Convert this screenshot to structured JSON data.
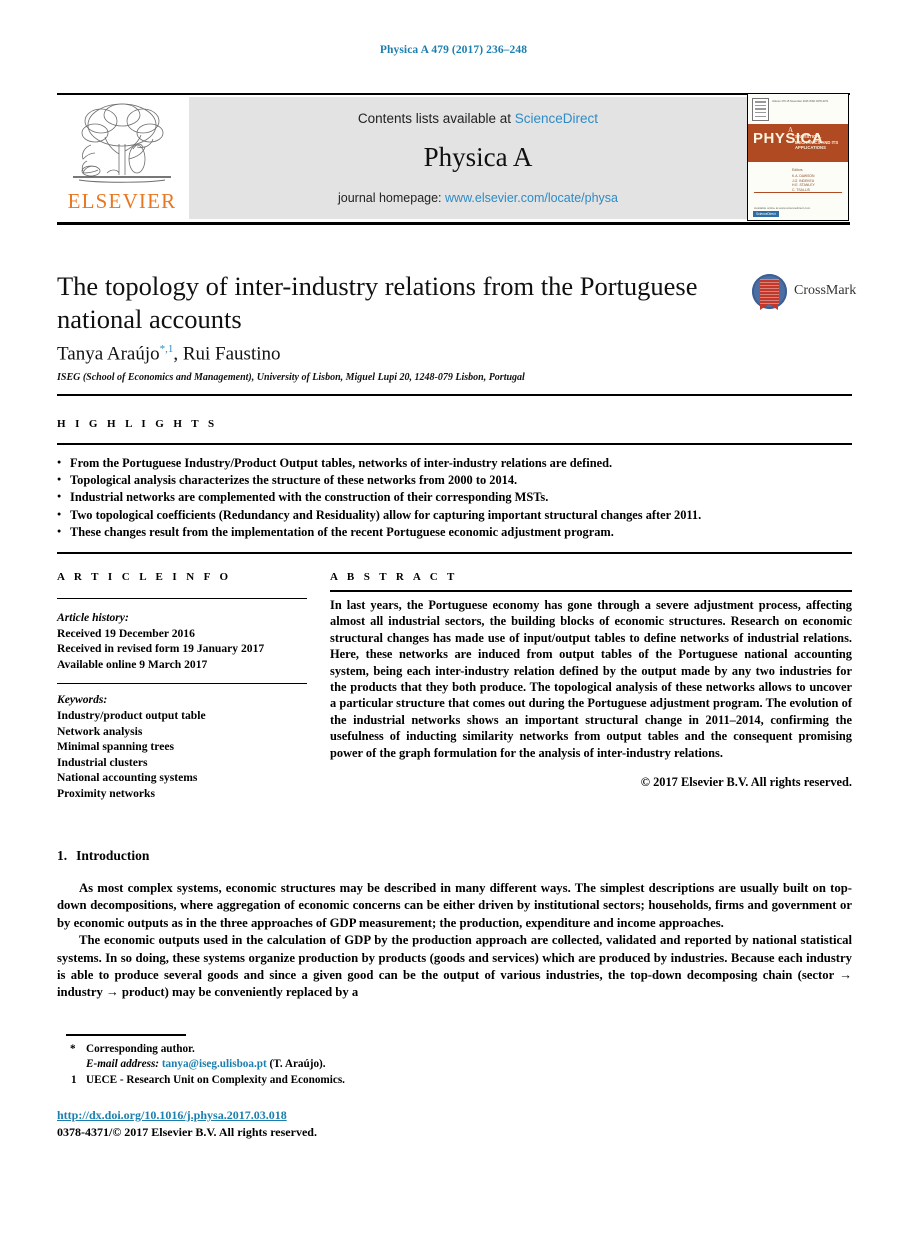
{
  "running_head": "Physica A 479 (2017) 236–248",
  "masthead": {
    "publisher_name": "ELSEVIER",
    "contents_prefix": "Contents lists available at",
    "contents_link": "ScienceDirect",
    "journal_title": "Physica A",
    "homepage_prefix": "journal homepage:",
    "homepage_link": "www.elsevier.com/locate/physa",
    "cover": {
      "title": "PHYSICA",
      "volume_letter": "A",
      "subtitle": "STATISTICAL MECHANICS AND ITS APPLICATIONS",
      "editors_label": "Editors",
      "editors": "K.A. DAWSON\nJ.O. INDEKEU\nH.E. STANLEY\nC. TSALLIS",
      "top_text": "Volume 479 15 November 2016 ISSN 0378-4371",
      "bottom_text": "Available online at www.sciencedirect.com",
      "badge": "ScienceDirect"
    }
  },
  "article": {
    "title": "The topology of inter-industry relations from the Portuguese national accounts",
    "authors": [
      {
        "name": "Tanya Araújo",
        "marks": "*,1"
      },
      {
        "name": "Rui Faustino",
        "marks": ""
      }
    ],
    "affiliation": "ISEG (School of Economics and Management), University of Lisbon, Miguel Lupi 20, 1248-079 Lisbon, Portugal",
    "crossmark_label": "CrossMark"
  },
  "highlights": {
    "label": "H I G H L I G H T S",
    "items": [
      "From the Portuguese Industry/Product Output tables, networks of inter-industry relations are defined.",
      "Topological analysis characterizes the structure of these networks from 2000 to 2014.",
      "Industrial networks are complemented with the construction of their corresponding MSTs.",
      "Two topological coefficients (Redundancy and Residuality) allow for capturing important structural changes after 2011.",
      "These changes result from the implementation of the recent Portuguese economic adjustment program."
    ]
  },
  "article_info": {
    "label": "A R T I C L E    I N F O",
    "history_label": "Article history:",
    "history": [
      "Received 19 December 2016",
      "Received in revised form 19 January 2017",
      "Available online 9 March 2017"
    ],
    "keywords_label": "Keywords:",
    "keywords": [
      "Industry/product output table",
      "Network analysis",
      "Minimal spanning trees",
      "Industrial clusters",
      "National accounting systems",
      "Proximity networks"
    ]
  },
  "abstract": {
    "label": "A B S T R A C T",
    "text": "In last years, the Portuguese economy has gone through a severe adjustment process, affecting almost all industrial sectors, the building blocks of economic structures. Research on economic structural changes has made use of input/output tables to define networks of industrial relations. Here, these networks are induced from output tables of the Portuguese national accounting system, being each inter-industry relation defined by the output made by any two industries for the products that they both produce. The topological analysis of these networks allows to uncover a particular structure that comes out during the Portuguese adjustment program. The evolution of the industrial networks shows an important structural change in 2011–2014, confirming the usefulness of inducting similarity networks from output tables and the consequent promising power of the graph formulation for the analysis of inter-industry relations.",
    "copyright": "© 2017 Elsevier B.V. All rights reserved."
  },
  "introduction": {
    "number": "1.",
    "title": "Introduction",
    "paragraphs": [
      "As most complex systems, economic structures may be described in many different ways. The simplest descriptions are usually built on top-down decompositions, where aggregation of economic concerns can be either driven by institutional sectors; households, firms and government or by economic outputs as in the three approaches of GDP measurement; the production, expenditure and income approaches.",
      "The economic outputs used in the calculation of GDP by the production approach are collected, validated and reported by national statistical systems. In so doing, these systems organize production by products (goods and services) which are produced by industries. Because each industry is able to produce several goods and since a given good can be the output of various industries, the top-down decomposing chain (sector → industry → product) may be conveniently replaced by a"
    ]
  },
  "footnotes": {
    "corresponding_mark": "*",
    "corresponding_text": "Corresponding author.",
    "email_label": "E-mail address:",
    "email": "tanya@iseg.ulisboa.pt",
    "email_owner": "(T. Araújo).",
    "note_mark": "1",
    "note_text": "UECE - Research Unit on Complexity and Economics.",
    "doi": "http://dx.doi.org/10.1016/j.physa.2017.03.018",
    "issn_line": "0378-4371/© 2017 Elsevier B.V. All rights reserved."
  },
  "colors": {
    "link": "#1a7fae",
    "sciencedirect": "#2e8bc6",
    "elsevier_orange": "#E87722",
    "banner_bg": "#e3e3e3",
    "cover_band": "#b04a22"
  }
}
